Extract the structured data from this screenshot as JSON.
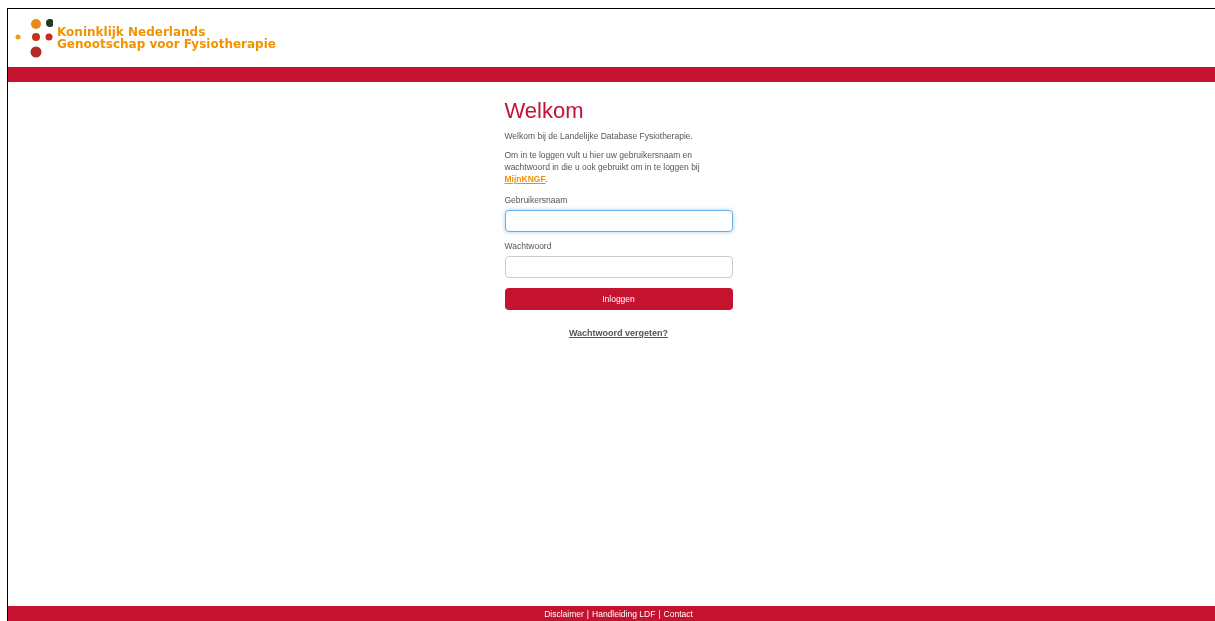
{
  "header": {
    "logo_lines": [
      "Koninklijk Nederlands",
      "Genootschap voor Fysiotherapie"
    ]
  },
  "login": {
    "title": "Welkom",
    "intro": "Welkom bij de Landelijke Database Fysiotherapie.",
    "instructions": "Om in te loggen vult u hier uw gebruikersnaam en wachtwoord in die u ook gebruikt om in te loggen bij ",
    "instructions_link": "MijnKNGF",
    "instructions_end": ".",
    "fields": [
      {
        "label": "Gebruikersnaam",
        "focused": true
      },
      {
        "label": "Wachtwoord",
        "focused": false
      }
    ],
    "submit": "Inloggen",
    "forgot": "Wachtwoord vergeten?"
  },
  "footer": {
    "links": [
      "Disclaimer",
      "Handleiding LDF",
      "Contact"
    ],
    "separator": "|"
  }
}
